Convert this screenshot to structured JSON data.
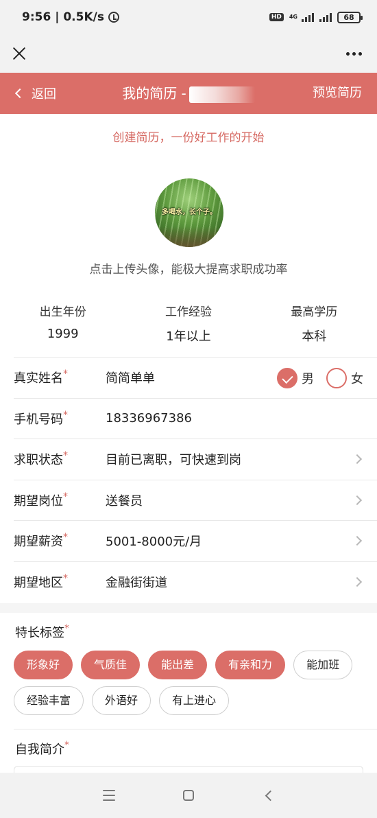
{
  "status": {
    "time": "9:56",
    "speed": "0.5K/s",
    "network": "4G",
    "battery": "68"
  },
  "header": {
    "back_label": "返回",
    "title": "我的简历 -",
    "preview_label": "预览简历"
  },
  "slogan": "创建简历，一份好工作的开始",
  "avatar": {
    "caption": "多喝水，长个子。",
    "hint": "点击上传头像，能极大提高求职成功率"
  },
  "stats": [
    {
      "label": "出生年份",
      "value": "1999"
    },
    {
      "label": "工作经验",
      "value": "1年以上"
    },
    {
      "label": "最高学历",
      "value": "本科"
    }
  ],
  "form": {
    "name": {
      "label": "真实姓名",
      "value": "简简单单"
    },
    "gender": {
      "male": "男",
      "female": "女",
      "selected": "男"
    },
    "phone": {
      "label": "手机号码",
      "value": "18336967386"
    },
    "job_status": {
      "label": "求职状态",
      "value": "目前已离职，可快速到岗"
    },
    "position": {
      "label": "期望岗位",
      "value": "送餐员"
    },
    "salary": {
      "label": "期望薪资",
      "value": "5001-8000元/月"
    },
    "region": {
      "label": "期望地区",
      "value": "金融街街道"
    },
    "required_mark": "*"
  },
  "skills": {
    "title": "特长标签",
    "tags": [
      {
        "label": "形象好",
        "selected": true
      },
      {
        "label": "气质佳",
        "selected": true
      },
      {
        "label": "能出差",
        "selected": true
      },
      {
        "label": "有亲和力",
        "selected": true
      },
      {
        "label": "能加班",
        "selected": false
      },
      {
        "label": "经验丰富",
        "selected": false
      },
      {
        "label": "外语好",
        "selected": false
      },
      {
        "label": "有上进心",
        "selected": false
      }
    ]
  },
  "intro": {
    "title": "自我简介"
  },
  "colors": {
    "accent": "#db6e68",
    "accent_text": "#d66a63"
  }
}
